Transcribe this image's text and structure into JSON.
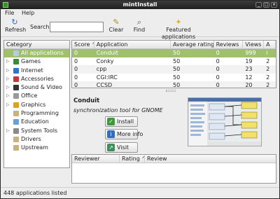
{
  "window": {
    "title": "mintInstall"
  },
  "menu": [
    "File",
    "Help"
  ],
  "toolbar": {
    "refresh_label": "Refresh",
    "search_label": "Search:",
    "search_value": "",
    "clear_label": "Clear",
    "find_label": "Find",
    "featured_label": "Featured applications"
  },
  "categories": {
    "header": "Category",
    "items": [
      {
        "label": "All applications",
        "expander": "",
        "selected": true,
        "color": "#b6c9e6"
      },
      {
        "label": "Games",
        "expander": "▷",
        "color": "#3a8a3a"
      },
      {
        "label": "Internet",
        "expander": "▷",
        "color": "#2d77c9"
      },
      {
        "label": "Accessories",
        "expander": "▷",
        "color": "#c03a3a"
      },
      {
        "label": "Sound & Video",
        "expander": "▷",
        "color": "#333333"
      },
      {
        "label": "Office",
        "expander": "▷",
        "color": "#9a9a9a"
      },
      {
        "label": "Graphics",
        "expander": "▷",
        "color": "#e0a21b"
      },
      {
        "label": "Programming",
        "expander": "",
        "color": "#c9b37a"
      },
      {
        "label": "Education",
        "expander": "",
        "color": "#6aa0d8"
      },
      {
        "label": "System Tools",
        "expander": "▷",
        "color": "#8a8a8a"
      },
      {
        "label": "Drivers",
        "expander": "",
        "color": "#c9b37a"
      },
      {
        "label": "Upstream",
        "expander": "",
        "color": "#c9b37a"
      }
    ]
  },
  "apps": {
    "columns": [
      "Score ^",
      "Application",
      "Average rating",
      "Reviews",
      "Views",
      "A"
    ],
    "rows": [
      {
        "score": "0",
        "name": "Conduit",
        "rating": "50",
        "reviews": "0",
        "views": "999",
        "a": "i"
      },
      {
        "score": "0",
        "name": "Conky",
        "rating": "50",
        "reviews": "0",
        "views": "19",
        "a": "2"
      },
      {
        "score": "0",
        "name": "cpp",
        "rating": "50",
        "reviews": "0",
        "views": "23",
        "a": "2"
      },
      {
        "score": "0",
        "name": "CGI:IRC",
        "rating": "50",
        "reviews": "0",
        "views": "12",
        "a": "2"
      },
      {
        "score": "0",
        "name": "CCSD",
        "rating": "50",
        "reviews": "0",
        "views": "20",
        "a": "2"
      }
    ]
  },
  "detail": {
    "name": "Conduit",
    "description": "synchronization tool for GNOME",
    "install_label": "Install",
    "more_info_label": "More info",
    "visit_label": "Visit"
  },
  "reviews": {
    "columns": [
      "Reviewer",
      "Rating ^",
      "Review"
    ]
  },
  "status": "448 applications listed"
}
